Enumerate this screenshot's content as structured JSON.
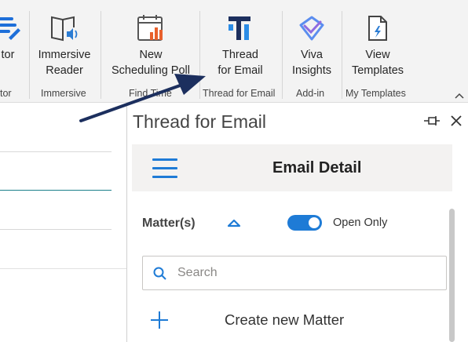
{
  "ribbon": {
    "buttons": [
      {
        "id": "editor",
        "label1": "tor",
        "label2": "",
        "icon": "editor-icon"
      },
      {
        "id": "immersive-reader",
        "label1": "Immersive",
        "label2": "Reader",
        "icon": "immersive-reader-icon"
      },
      {
        "id": "scheduling-poll",
        "label1": "New",
        "label2": "Scheduling Poll",
        "icon": "scheduling-poll-icon"
      },
      {
        "id": "thread-for-email",
        "label1": "Thread",
        "label2": "for Email",
        "icon": "thread-logo-icon"
      },
      {
        "id": "viva-insights",
        "label1": "Viva",
        "label2": "Insights",
        "icon": "viva-insights-icon"
      },
      {
        "id": "view-templates",
        "label1": "View",
        "label2": "Templates",
        "icon": "templates-icon"
      }
    ],
    "groups": {
      "editor": "tor",
      "immersive": "Immersive",
      "find_time": "Find Time",
      "thread": "Thread for Email",
      "addin": "Add-in",
      "templates": "My Templates"
    },
    "colors": {
      "thread_dark": "#1c2f5e",
      "thread_blue": "#2b8ce6",
      "poll_orange": "#e8602c",
      "viva": "#5b8def"
    }
  },
  "task_pane": {
    "title": "Thread for Email",
    "header": "Email Detail",
    "matters_label": "Matter(s)",
    "toggle_label": "Open Only",
    "toggle_on": true,
    "search": {
      "placeholder": "Search",
      "value": ""
    },
    "create_label": "Create new Matter",
    "accent": "#1e7bd6"
  },
  "annotation": {
    "arrow_color": "#1c2f5e"
  }
}
